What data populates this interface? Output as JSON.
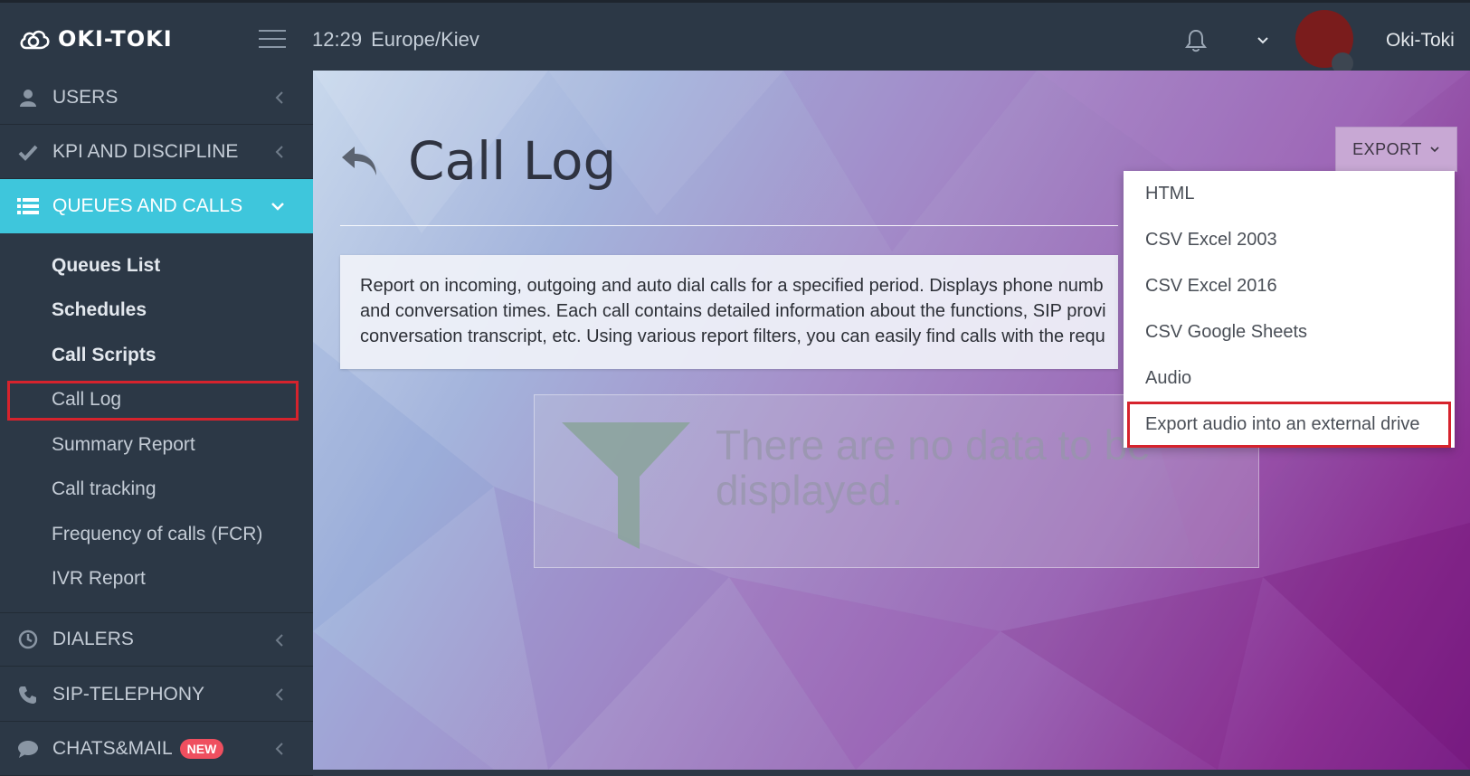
{
  "header": {
    "brand": "OKI-TOKI",
    "time": "12:29",
    "timezone": "Europe/Kiev",
    "username": "Oki-Toki"
  },
  "sidebar": {
    "sections": [
      {
        "label": "USERS",
        "icon": "user-icon"
      },
      {
        "label": "KPI AND DISCIPLINE",
        "icon": "check-icon"
      },
      {
        "label": "QUEUES AND CALLS",
        "icon": "list-icon",
        "active": true
      },
      {
        "label": "DIALERS",
        "icon": "clock-icon"
      },
      {
        "label": "SIP-TELEPHONY",
        "icon": "phone-icon"
      },
      {
        "label": "CHATS&MAIL",
        "icon": "chat-icon",
        "badge": "NEW"
      }
    ],
    "sub_items": [
      {
        "label": "Queues List"
      },
      {
        "label": "Schedules"
      },
      {
        "label": "Call Scripts"
      },
      {
        "label": "Call Log"
      },
      {
        "label": "Summary Report"
      },
      {
        "label": "Call tracking"
      },
      {
        "label": "Frequency of calls (FCR)"
      },
      {
        "label": "IVR Report"
      }
    ]
  },
  "main": {
    "title": "Call Log",
    "export_label": "EXPORT",
    "description": [
      "Report on incoming, outgoing and auto dial calls for a specified period. Displays phone numb",
      "and conversation times. Each call contains detailed information about the functions, SIP provi",
      "conversation transcript, etc. Using various report filters, you can easily find calls with the requ"
    ],
    "empty_message": [
      "There are no data to be",
      "displayed."
    ]
  },
  "export_menu": {
    "items": [
      "HTML",
      "CSV Excel 2003",
      "CSV Excel 2016",
      "CSV Google Sheets",
      "Audio",
      "Export audio into an external drive"
    ]
  },
  "colors": {
    "sidebar_bg": "#2c3846",
    "active": "#3ec6dc",
    "highlight": "#d6232d",
    "badge": "#ef4f5f"
  }
}
